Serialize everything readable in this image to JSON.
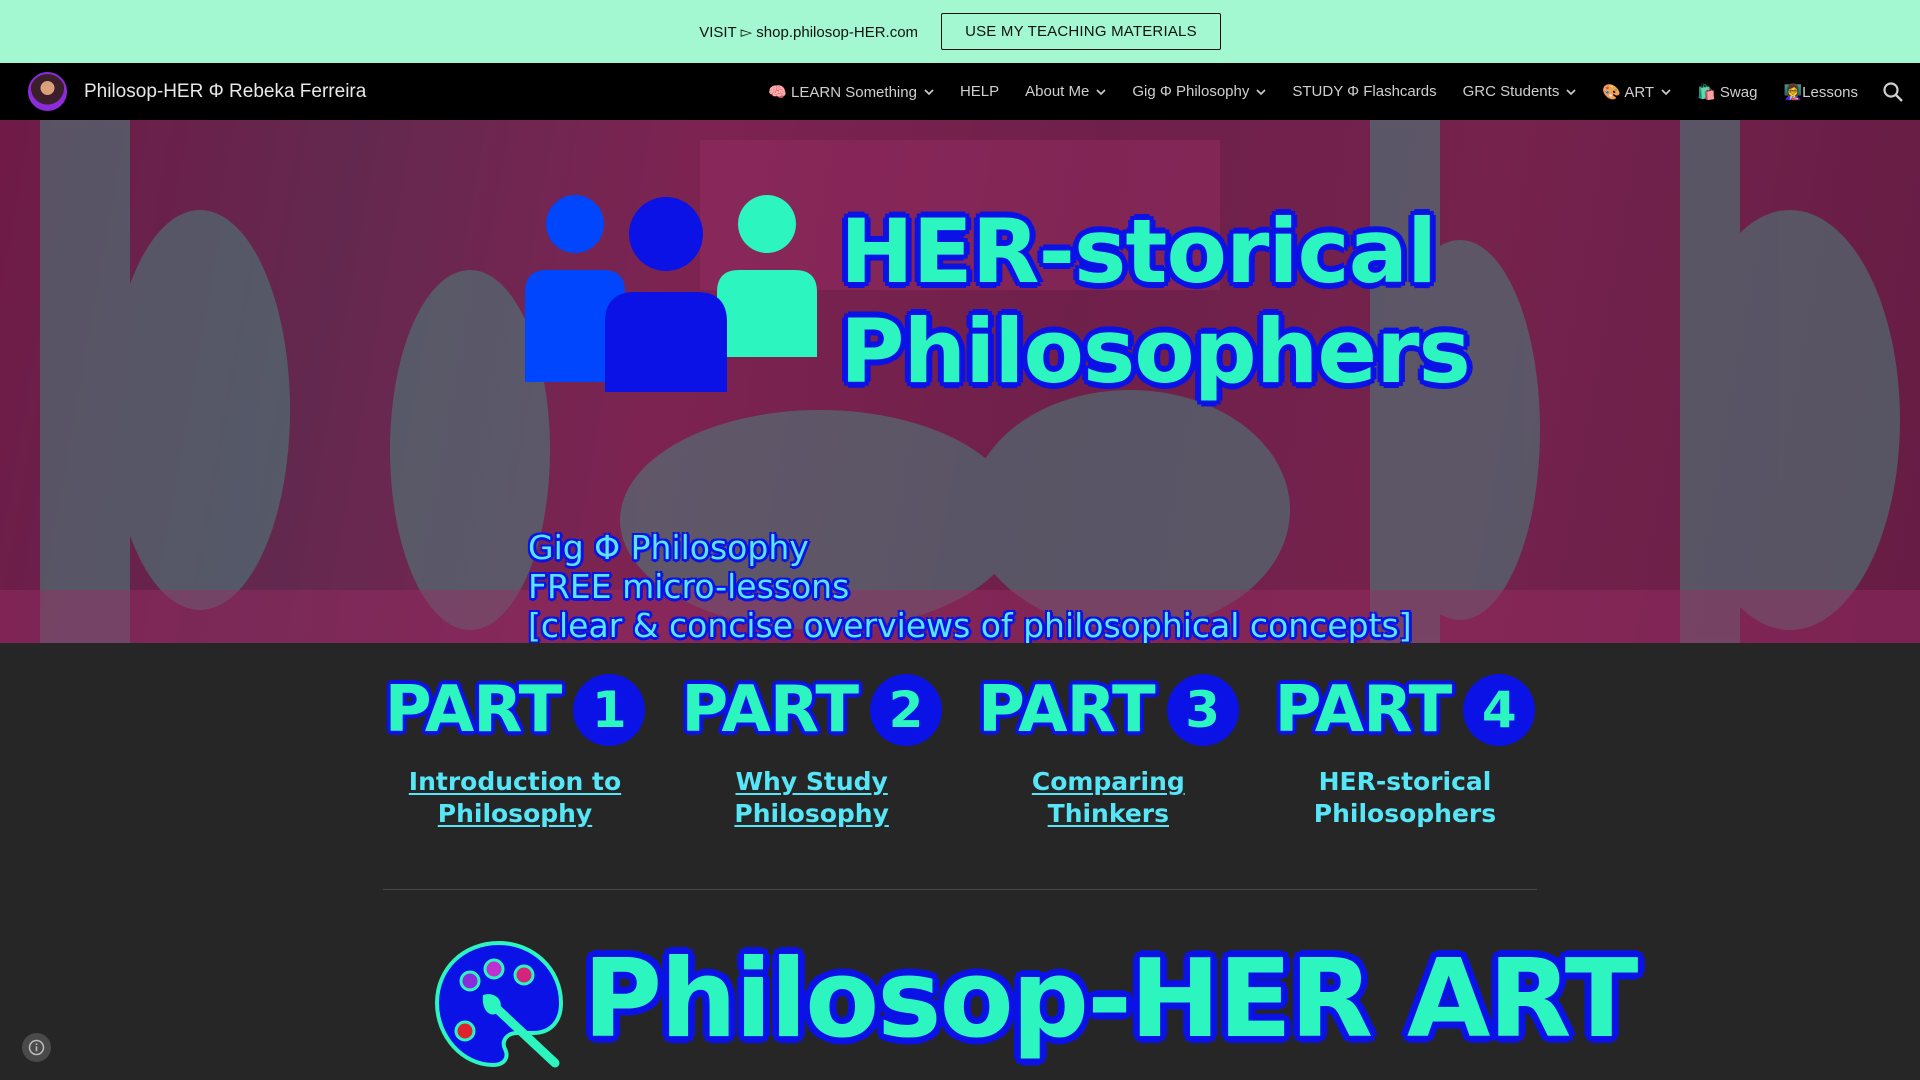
{
  "announcement": {
    "text": "VISIT ▻ shop.philosop-HER.com",
    "button_label": "USE MY TEACHING MATERIALS"
  },
  "nav": {
    "brand_title": "Philosop-HER Φ Rebeka Ferreira",
    "items": [
      {
        "label": "🧠 LEARN Something",
        "dropdown": true
      },
      {
        "label": "HELP",
        "dropdown": false
      },
      {
        "label": "About Me",
        "dropdown": true
      },
      {
        "label": "Gig Φ Philosophy",
        "dropdown": true
      },
      {
        "label": "STUDY Φ Flashcards",
        "dropdown": false
      },
      {
        "label": "GRC Students",
        "dropdown": true
      },
      {
        "label": "🎨 ART",
        "dropdown": true
      },
      {
        "label": "🛍️ Swag",
        "dropdown": false
      },
      {
        "label": "👩‍🏫Lessons",
        "dropdown": false
      }
    ]
  },
  "hero": {
    "title_line1": "HER-storical",
    "title_line2": "Philosophers",
    "sub_line1": "Gig Φ Philosophy",
    "sub_line2": "FREE micro-lessons",
    "sub_line3": "[clear & concise overviews of philosophical concepts]"
  },
  "parts": [
    {
      "word": "PART",
      "number": "1",
      "link_line1": "Introduction to",
      "link_line2": "Philosophy"
    },
    {
      "word": "PART",
      "number": "2",
      "link_line1": "Why Study",
      "link_line2": "Philosophy"
    },
    {
      "word": "PART",
      "number": "3",
      "link_line1": "Comparing Thinkers",
      "link_line2": ""
    },
    {
      "word": "PART",
      "number": "4",
      "link_line1": "HER-storical",
      "link_line2": "Philosophers"
    }
  ],
  "art": {
    "title": "Philosop-HER ART"
  },
  "colors": {
    "announce_bg": "#a3f8d2",
    "accent_teal": "#2cf5c0",
    "accent_blue": "#0b12e6",
    "link_cyan": "#57e6f7",
    "page_bg": "#262626"
  },
  "icons": [
    "people-icon",
    "search-icon",
    "chevron-down-icon",
    "palette-icon",
    "info-icon"
  ]
}
